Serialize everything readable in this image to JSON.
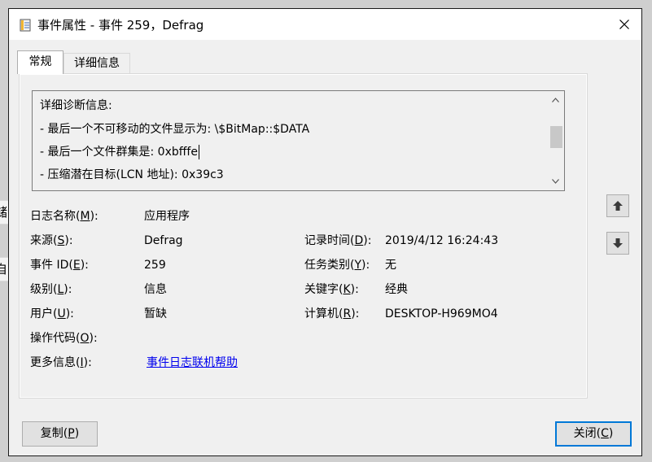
{
  "window": {
    "title": "事件属性 - 事件 259，Defrag",
    "icon": "event-viewer-icon",
    "close_icon": "close-icon"
  },
  "background_app": {
    "fragment_1": "储",
    "fragment_2": "自"
  },
  "tabs": [
    {
      "label": "常规",
      "selected": true
    },
    {
      "label": "详细信息",
      "selected": false
    }
  ],
  "description": {
    "lines": [
      "详细诊断信息:",
      "- 最后一个不可移动的文件显示为: \\$BitMap::$DATA",
      "- 最后一个文件群集是: 0xbfffe",
      "- 压缩潜在目标(LCN 地址): 0x39c3"
    ]
  },
  "fields": {
    "log_name": {
      "label": "日志名称(M):",
      "mnemonic": "M",
      "value": "应用程序"
    },
    "source": {
      "label": "来源(S):",
      "mnemonic": "S",
      "value": "Defrag"
    },
    "logged": {
      "label": "记录时间(D):",
      "mnemonic": "D",
      "value": "2019/4/12 16:24:43"
    },
    "event_id": {
      "label": "事件 ID(E):",
      "mnemonic": "E",
      "value": "259"
    },
    "task_category": {
      "label": "任务类别(Y):",
      "mnemonic": "Y",
      "value": "无"
    },
    "level": {
      "label": "级别(L):",
      "mnemonic": "L",
      "value": "信息"
    },
    "keywords": {
      "label": "关键字(K):",
      "mnemonic": "K",
      "value": "经典"
    },
    "user": {
      "label": "用户(U):",
      "mnemonic": "U",
      "value": "暂缺"
    },
    "computer": {
      "label": "计算机(R):",
      "mnemonic": "R",
      "value": "DESKTOP-H969MO4"
    },
    "opcode": {
      "label": "操作代码(O):",
      "mnemonic": "O",
      "value": ""
    },
    "more_info": {
      "label": "更多信息(I):",
      "mnemonic": "I",
      "link": "事件日志联机帮助"
    }
  },
  "buttons": {
    "copy": "复制(P)",
    "close": "关闭(C)"
  },
  "colors": {
    "dialog_bg": "#f0f0f0",
    "link": "#0000ee",
    "default_button_border": "#0078d7"
  }
}
